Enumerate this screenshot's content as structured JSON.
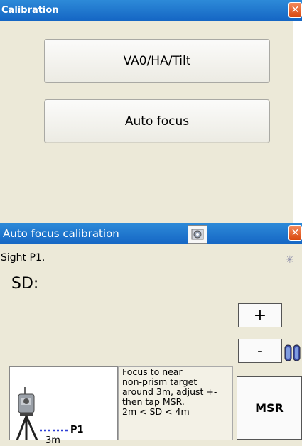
{
  "calibration_window": {
    "title": "Calibration",
    "close_label": "✕",
    "buttons": [
      "VA0/HA/Tilt",
      "Auto focus"
    ]
  },
  "autofocus_window": {
    "title": "Auto focus calibration",
    "close_label": "✕",
    "sight_label": "Sight P1.",
    "sd_label": "SD:",
    "plus_label": "+",
    "minus_label": "-",
    "msr_label": "MSR",
    "diagram": {
      "target_label": "P1",
      "distance_label": "3m"
    },
    "instructions": [
      "Focus to near",
      "non-prism target",
      "around 3m, adjust +-",
      "then tap MSR.",
      "2m < SD < 4m"
    ],
    "icons": {
      "tilt": "tilt-sensor-icon",
      "laser": "laser-pointer-icon",
      "battery": "battery-icon",
      "instrument": "total-station-icon"
    }
  },
  "colors": {
    "titlebar": "#1a6fcc",
    "close": "#e05a1f",
    "background": "#ece9d8"
  }
}
